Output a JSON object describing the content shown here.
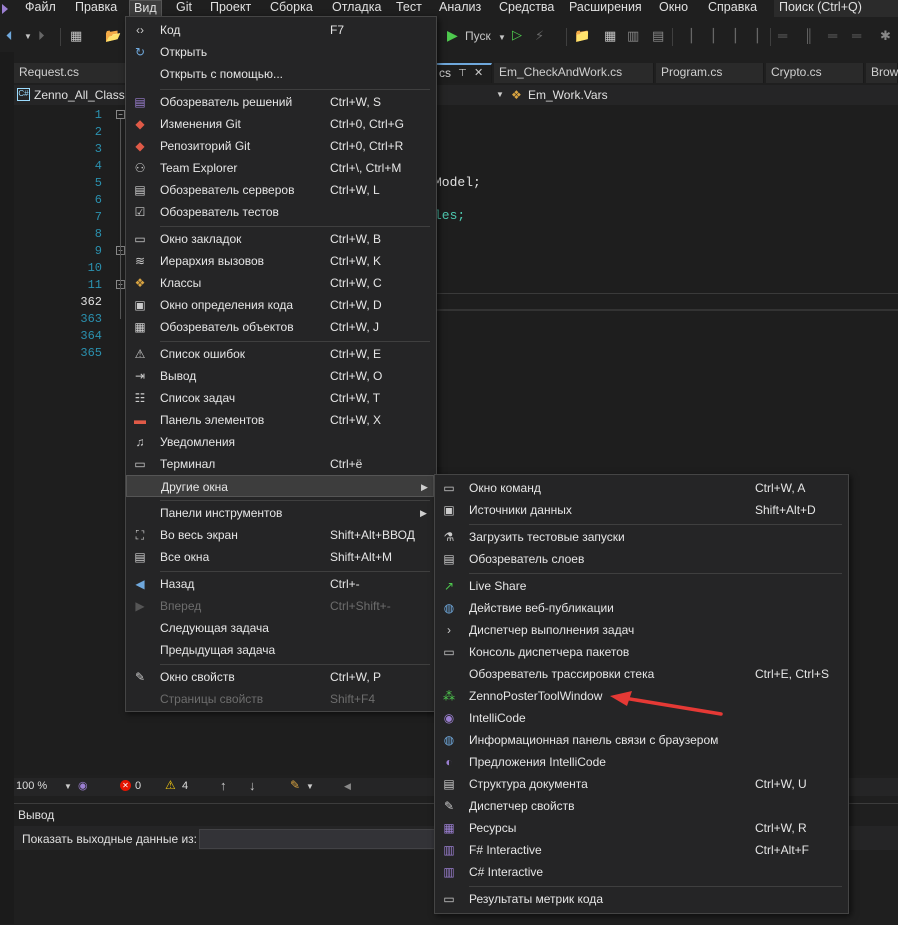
{
  "menubar": {
    "items": [
      "Файл",
      "Правка",
      "Вид",
      "Git",
      "Проект",
      "Сборка",
      "Отладка",
      "Тест",
      "Анализ",
      "Средства",
      "Расширения",
      "Окно",
      "Справка"
    ],
    "search": "Поиск (Ctrl+Q)"
  },
  "toolbar": {
    "run_label": "Пуск"
  },
  "tabs": [
    "Request.cs",
    "cs",
    "Em_CheckAndWork.cs",
    "Program.cs",
    "Crypto.cs",
    "Brows"
  ],
  "navbar": {
    "project": "Zenno_All_Class",
    "member": "Em_Work.Vars"
  },
  "editor": {
    "line_numbers": [
      "1",
      "2",
      "3",
      "4",
      "5",
      "6",
      "7",
      "8",
      "9",
      "10",
      "11",
      "362",
      "363",
      "364",
      "365"
    ],
    "current_line": "362",
    "code_fragments": [
      "Model;",
      "les;"
    ]
  },
  "statusbar": {
    "zoom": "100 %",
    "errors": "0",
    "warnings": "4"
  },
  "output": {
    "title": "Вывод",
    "show_from_label": "Показать выходные данные из:"
  },
  "view_menu": {
    "items": [
      {
        "label": "Код",
        "shortcut": "F7",
        "icon": "code-icon"
      },
      {
        "label": "Открыть",
        "shortcut": "",
        "icon": "open-icon"
      },
      {
        "label": "Открыть с помощью...",
        "shortcut": "",
        "icon": ""
      },
      {
        "label": "Обозреватель решений",
        "shortcut": "Ctrl+W, S",
        "icon": "solution-explorer-icon"
      },
      {
        "label": "Изменения Git",
        "shortcut": "Ctrl+0, Ctrl+G",
        "icon": "git-changes-icon"
      },
      {
        "label": "Репозиторий Git",
        "shortcut": "Ctrl+0, Ctrl+R",
        "icon": "git-repository-icon"
      },
      {
        "label": "Team Explorer",
        "shortcut": "Ctrl+\\, Ctrl+M",
        "icon": "team-explorer-icon"
      },
      {
        "label": "Обозреватель серверов",
        "shortcut": "Ctrl+W, L",
        "icon": "server-explorer-icon"
      },
      {
        "label": "Обозреватель тестов",
        "shortcut": "",
        "icon": "test-explorer-icon"
      },
      {
        "label": "Окно закладок",
        "shortcut": "Ctrl+W, B",
        "icon": "bookmarks-icon"
      },
      {
        "label": "Иерархия вызовов",
        "shortcut": "Ctrl+W, K",
        "icon": "call-hierarchy-icon"
      },
      {
        "label": "Классы",
        "shortcut": "Ctrl+W, C",
        "icon": "class-view-icon"
      },
      {
        "label": "Окно определения кода",
        "shortcut": "Ctrl+W, D",
        "icon": "code-definition-icon"
      },
      {
        "label": "Обозреватель объектов",
        "shortcut": "Ctrl+W, J",
        "icon": "object-browser-icon"
      },
      {
        "label": "Список ошибок",
        "shortcut": "Ctrl+W, E",
        "icon": "error-list-icon"
      },
      {
        "label": "Вывод",
        "shortcut": "Ctrl+W, O",
        "icon": "output-icon"
      },
      {
        "label": "Список задач",
        "shortcut": "Ctrl+W, T",
        "icon": "task-list-icon"
      },
      {
        "label": "Панель элементов",
        "shortcut": "Ctrl+W, X",
        "icon": "toolbox-icon"
      },
      {
        "label": "Уведомления",
        "shortcut": "",
        "icon": "bell-icon"
      },
      {
        "label": "Терминал",
        "shortcut": "Ctrl+ё",
        "icon": "terminal-icon"
      },
      {
        "label": "Другие окна",
        "shortcut": "",
        "icon": ""
      },
      {
        "label": "Панели инструментов",
        "shortcut": "",
        "icon": ""
      },
      {
        "label": "Во весь экран",
        "shortcut": "Shift+Alt+ВВОД",
        "icon": "fullscreen-icon"
      },
      {
        "label": "Все окна",
        "shortcut": "Shift+Alt+M",
        "icon": "all-windows-icon"
      },
      {
        "label": "Назад",
        "shortcut": "Ctrl+-",
        "icon": "back-icon"
      },
      {
        "label": "Вперед",
        "shortcut": "Ctrl+Shift+-",
        "icon": "forward-icon"
      },
      {
        "label": "Следующая задача",
        "shortcut": "",
        "icon": ""
      },
      {
        "label": "Предыдущая задача",
        "shortcut": "",
        "icon": ""
      },
      {
        "label": "Окно свойств",
        "shortcut": "Ctrl+W, P",
        "icon": "wrench-icon"
      },
      {
        "label": "Страницы свойств",
        "shortcut": "Shift+F4",
        "icon": ""
      }
    ]
  },
  "other_windows_menu": {
    "items": [
      {
        "label": "Окно команд",
        "shortcut": "Ctrl+W, A",
        "icon": "command-window-icon"
      },
      {
        "label": "Источники данных",
        "shortcut": "Shift+Alt+D",
        "icon": "data-sources-icon"
      },
      {
        "label": "Загрузить тестовые запуски",
        "shortcut": "",
        "icon": "flask-icon"
      },
      {
        "label": "Обозреватель слоев",
        "shortcut": "",
        "icon": "layer-explorer-icon"
      },
      {
        "label": "Live Share",
        "shortcut": "",
        "icon": "live-share-icon"
      },
      {
        "label": "Действие веб-публикации",
        "shortcut": "",
        "icon": "globe-icon"
      },
      {
        "label": "Диспетчер выполнения задач",
        "shortcut": "",
        "icon": "chevron-right-icon"
      },
      {
        "label": "Консоль диспетчера пакетов",
        "shortcut": "",
        "icon": "console-icon"
      },
      {
        "label": "Обозреватель трассировки стека",
        "shortcut": "Ctrl+E, Ctrl+S",
        "icon": ""
      },
      {
        "label": "ZennoPosterToolWindow",
        "shortcut": "",
        "icon": "zenno-icon"
      },
      {
        "label": "IntelliCode",
        "shortcut": "",
        "icon": "intellicode-icon"
      },
      {
        "label": "Информационная панель связи с браузером",
        "shortcut": "",
        "icon": "globe-icon"
      },
      {
        "label": "Предложения IntelliCode",
        "shortcut": "",
        "icon": "lightbulb-icon"
      },
      {
        "label": "Структура документа",
        "shortcut": "Ctrl+W, U",
        "icon": "document-outline-icon"
      },
      {
        "label": "Диспетчер свойств",
        "shortcut": "",
        "icon": "wrench-icon"
      },
      {
        "label": "Ресурсы",
        "shortcut": "Ctrl+W, R",
        "icon": "resources-icon"
      },
      {
        "label": "F# Interactive",
        "shortcut": "Ctrl+Alt+F",
        "icon": "fsharp-icon"
      },
      {
        "label": "C# Interactive",
        "shortcut": "",
        "icon": "csharp-icon"
      },
      {
        "label": "Результаты метрик кода",
        "shortcut": "",
        "icon": "code-metrics-icon"
      }
    ]
  },
  "colors": {
    "accent_arrow": "#e53935",
    "menu_bg": "#252526",
    "highlight": "#3d3d3d"
  }
}
